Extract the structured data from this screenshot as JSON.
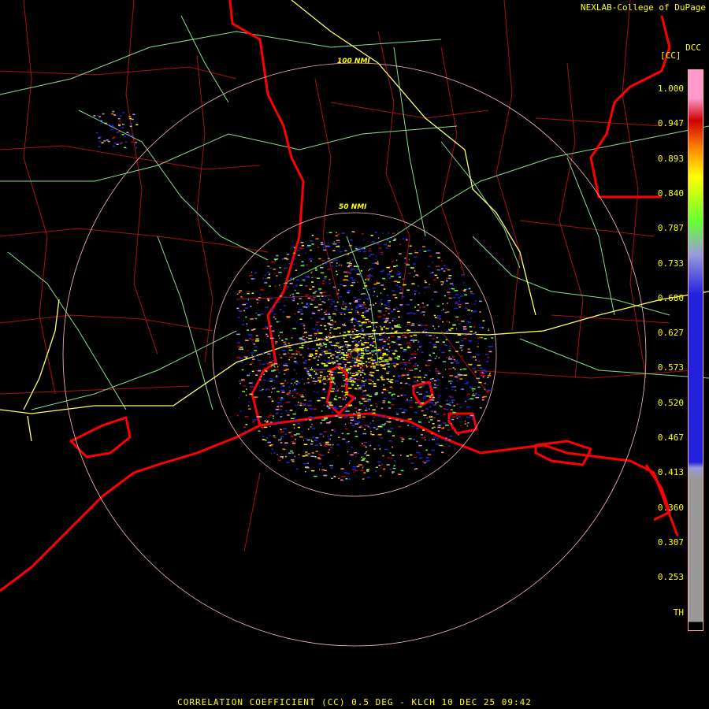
{
  "credit": "NEXLAB-College of DuPage",
  "product_code": "DCC",
  "unit_label": "[CC]",
  "footer": "CORRELATION COEFFICIENT (CC) 0.5 DEG - KLCH 10 DEC 25 09:42",
  "range_rings": [
    {
      "label": "50 NMI"
    },
    {
      "label": "100 NMI"
    }
  ],
  "colorbar": {
    "ticks": [
      "1.000",
      "0.947",
      "0.893",
      "0.840",
      "0.787",
      "0.733",
      "0.680",
      "0.627",
      "0.573",
      "0.520",
      "0.467",
      "0.413",
      "0.360",
      "0.307",
      "0.253",
      "TH"
    ],
    "colors": {
      "pink": "#ff99cc",
      "red": "#cc0000",
      "orange": "#ff8800",
      "yellow": "#ffff00",
      "green": "#66ff33",
      "lavender": "#9999dd",
      "blue": "#2222dd",
      "gray": "#999999",
      "black": "#000000"
    }
  },
  "colors": {
    "state_borders": "#ff0000",
    "county_lines": "#aa1111",
    "highways": "#88dd88",
    "interstates": "#ffff66",
    "rings": "#ffbbbb",
    "text": "#ffff00"
  }
}
